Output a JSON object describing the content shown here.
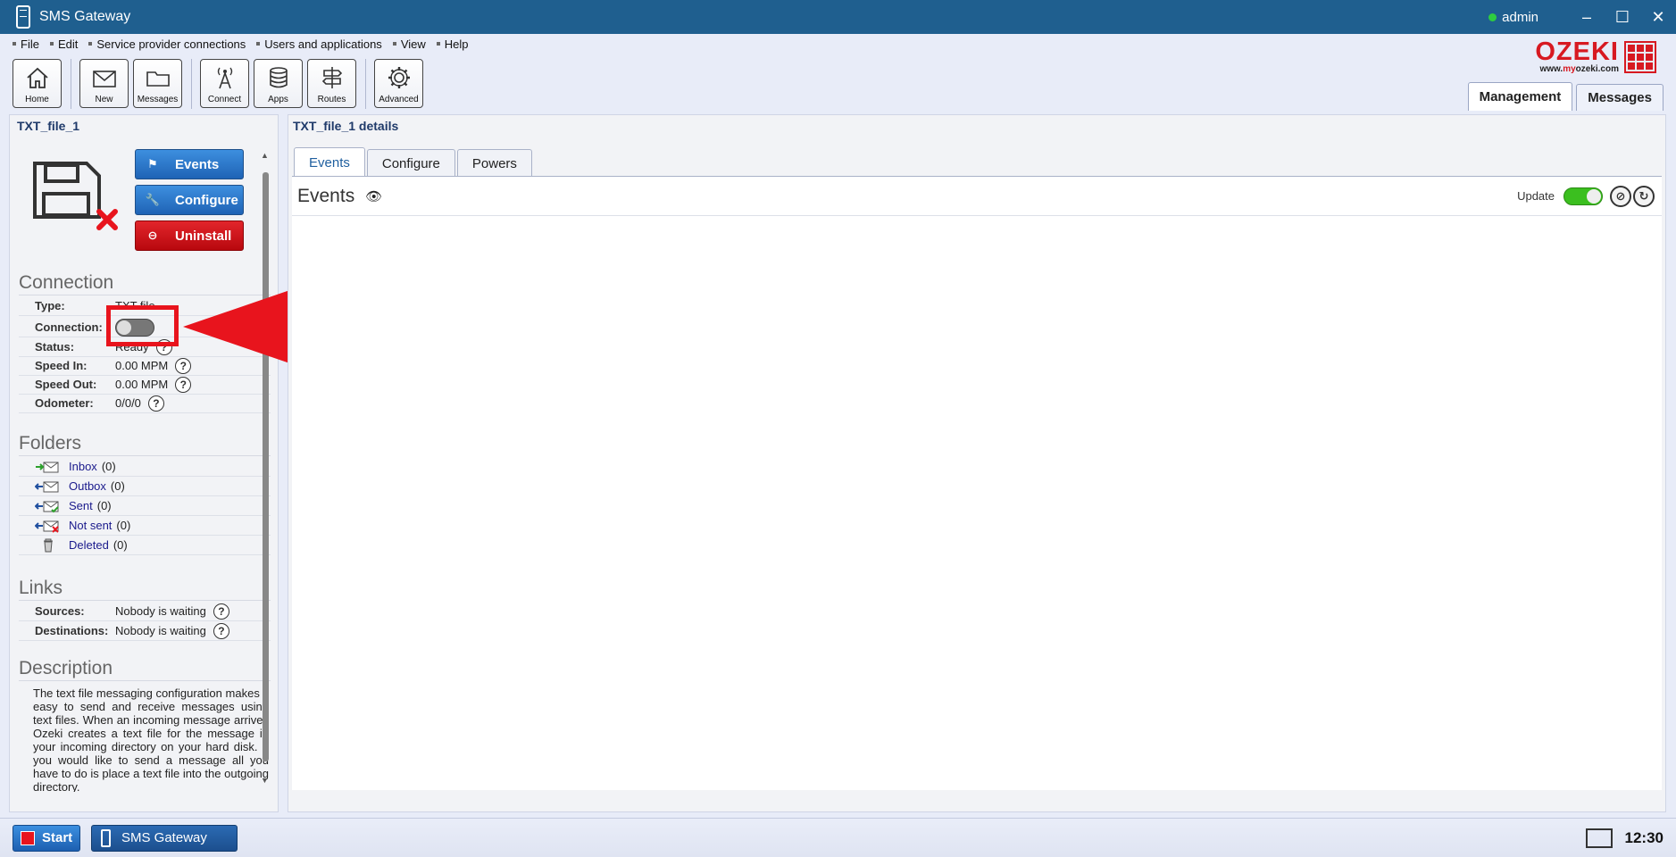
{
  "window": {
    "title": "SMS Gateway",
    "user": "admin",
    "minimize": "–",
    "maximize": "☐",
    "close": "✕"
  },
  "menu": [
    "File",
    "Edit",
    "Service provider connections",
    "Users and applications",
    "View",
    "Help"
  ],
  "toolbar": {
    "home": "Home",
    "new": "New",
    "messages": "Messages",
    "connect": "Connect",
    "apps": "Apps",
    "routes": "Routes",
    "advanced": "Advanced"
  },
  "logo": {
    "brand": "OZEKI",
    "url_prefix": "www.",
    "url_my": "my",
    "url_suffix": "ozeki.com"
  },
  "main_tabs": {
    "management": "Management",
    "messages": "Messages"
  },
  "left": {
    "title": "TXT_file_1",
    "buttons": {
      "events": "Events",
      "configure": "Configure",
      "uninstall": "Uninstall"
    },
    "connection": {
      "heading": "Connection",
      "type_label": "Type:",
      "type_value": "TXT file",
      "connection_label": "Connection:",
      "status_label": "Status:",
      "status_value": "Ready",
      "speed_in_label": "Speed In:",
      "speed_in_value": "0.00 MPM",
      "speed_out_label": "Speed Out:",
      "speed_out_value": "0.00 MPM",
      "odometer_label": "Odometer:",
      "odometer_value": "0/0/0",
      "help": "?"
    },
    "folders": {
      "heading": "Folders",
      "inbox": "Inbox",
      "inbox_count": "(0)",
      "outbox": "Outbox",
      "outbox_count": "(0)",
      "sent": "Sent",
      "sent_count": "(0)",
      "notsent": "Not sent",
      "notsent_count": "(0)",
      "deleted": "Deleted",
      "deleted_count": "(0)"
    },
    "links": {
      "heading": "Links",
      "sources_label": "Sources:",
      "sources_value": "Nobody is waiting",
      "destinations_label": "Destinations:",
      "destinations_value": "Nobody is waiting"
    },
    "description": {
      "heading": "Description",
      "text": "The text file messaging configuration makes it easy to send and receive messages using text files. When an incoming message arrives Ozeki creates a text file for the message in your incoming directory on your hard disk. If you would like to send a message all you have to do is place a text file into the outgoing directory."
    }
  },
  "right": {
    "title": "TXT_file_1 details",
    "tabs": [
      "Events",
      "Configure",
      "Powers"
    ],
    "events_title": "Events",
    "update_label": "Update"
  },
  "taskbar": {
    "start": "Start",
    "app": "SMS Gateway",
    "clock": "12:30"
  },
  "colors": {
    "titlebar": "#1f5f8f",
    "accent_red": "#e8141d",
    "button_blue": "#1f63b5",
    "toggle_on": "#3bbf1f"
  }
}
